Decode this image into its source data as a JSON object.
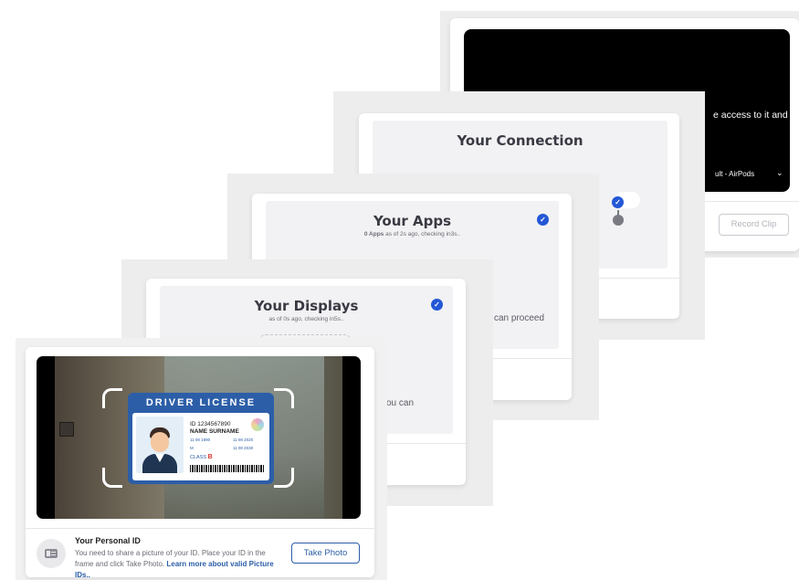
{
  "connection": {
    "title": "Your Connection",
    "video_text": "e access to it and",
    "audio_device": "ult - AirPods",
    "record_button": "Record Clip"
  },
  "apps": {
    "title": "Your Apps",
    "count": "0 Apps",
    "status": "as of 2s ago, checking in3s..",
    "partial_text": "can proceed"
  },
  "displays": {
    "title": "Your Displays",
    "status": "as of 0s ago, checking in5s..",
    "partial_text": "ou can"
  },
  "personal_id": {
    "title": "Your Personal ID",
    "description": "You need to share a picture of your ID. Place your ID in the frame and click Take Photo.",
    "learn_more": "Learn more about valid Picture IDs..",
    "take_photo": "Take Photo",
    "license": {
      "heading": "DRIVER LICENSE",
      "id_line": "ID 1234567890",
      "name_line": "NAME SURNAME",
      "dob": "11 08 1990",
      "issued": "11 08 2020",
      "sex": "M",
      "expires": "11 08 2030",
      "class_label": "CLASS",
      "class_value": "B"
    }
  },
  "icons": {
    "check": "check-circle-icon",
    "chevron": "chevron-down-icon",
    "id_card": "id-card-icon"
  },
  "colors": {
    "accent": "#2457d6",
    "license_blue": "#2c5ea8",
    "class_red": "#d9342b"
  }
}
